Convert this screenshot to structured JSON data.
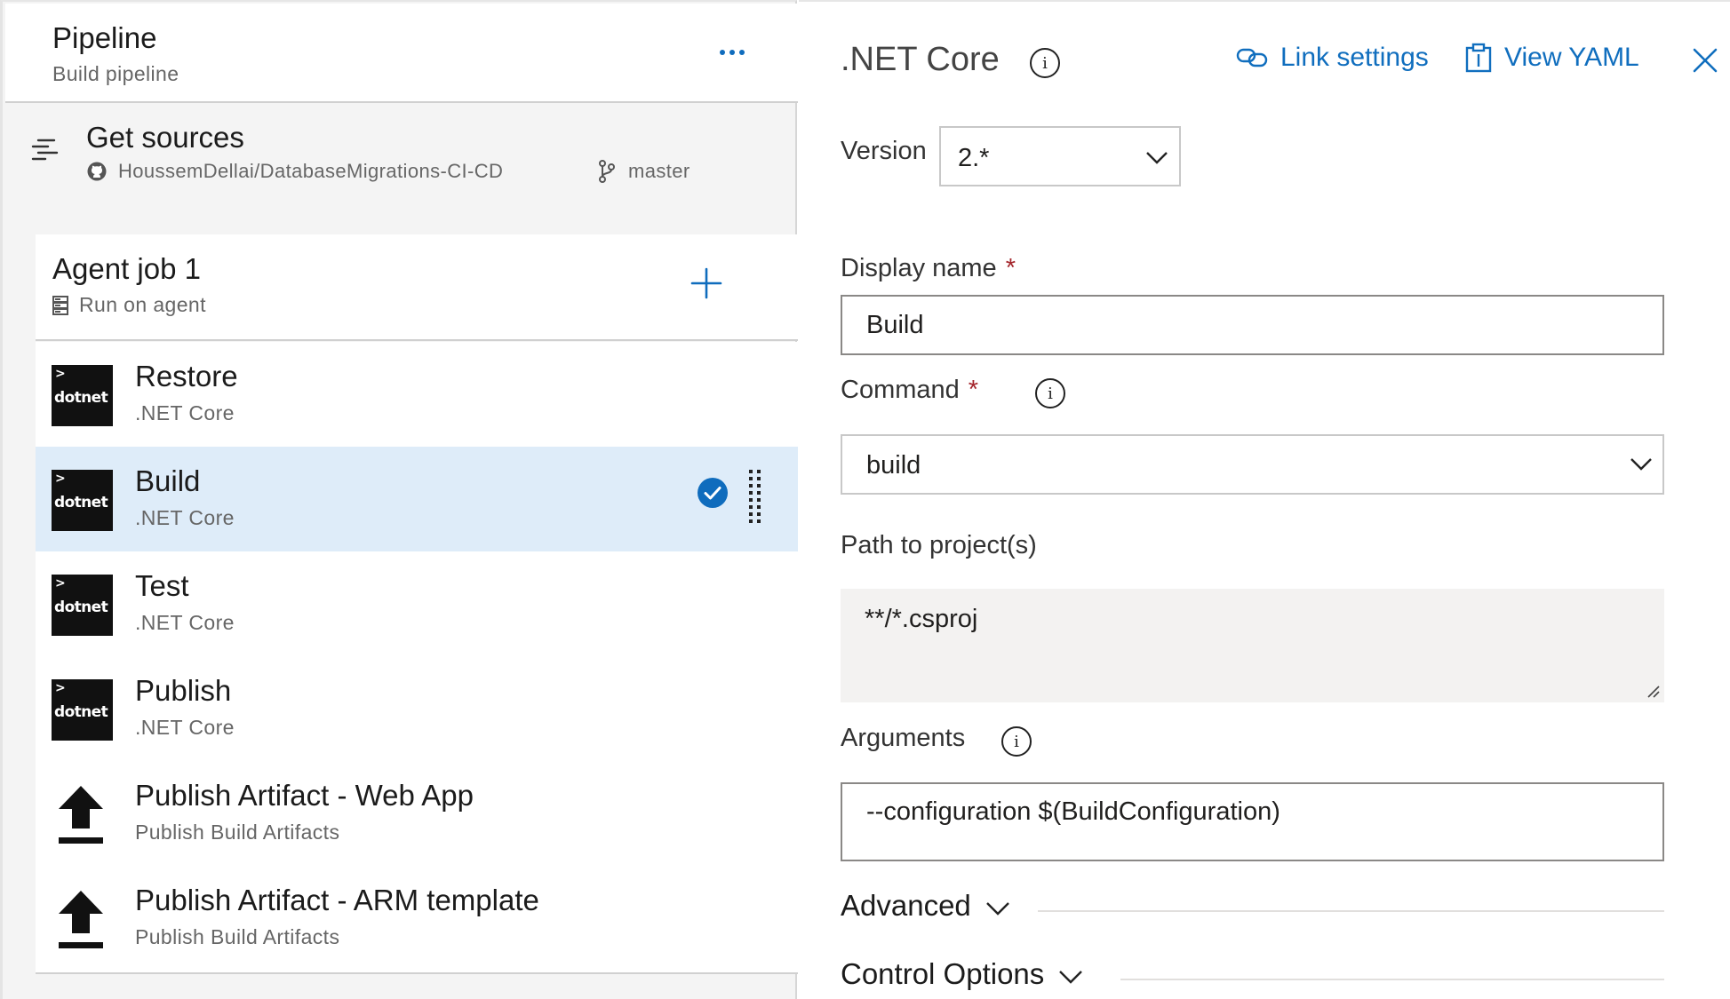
{
  "pipeline": {
    "title": "Pipeline",
    "subtitle": "Build pipeline"
  },
  "sources": {
    "title": "Get sources",
    "repo": "HoussemDellai/DatabaseMigrations-CI-CD",
    "branch": "master"
  },
  "agent_job": {
    "title": "Agent job 1",
    "subtitle": "Run on agent"
  },
  "tasks": [
    {
      "name": "Restore",
      "type": ".NET Core",
      "icon": "dotnet-logo"
    },
    {
      "name": "Build",
      "type": ".NET Core",
      "icon": "dotnet-logo",
      "selected": true
    },
    {
      "name": "Test",
      "type": ".NET Core",
      "icon": "dotnet-logo"
    },
    {
      "name": "Publish",
      "type": ".NET Core",
      "icon": "dotnet-logo"
    },
    {
      "name": "Publish Artifact - Web App",
      "type": "Publish Build Artifacts",
      "icon": "upload-icon"
    },
    {
      "name": "Publish Artifact - ARM template",
      "type": "Publish Build Artifacts",
      "icon": "upload-icon"
    }
  ],
  "dotnet_logo_text": "dotnet",
  "detail": {
    "title": ".NET Core",
    "link_settings": "Link settings",
    "view_yaml": "View YAML",
    "version": {
      "label": "Version",
      "value": "2.*"
    },
    "display_name": {
      "label": "Display name",
      "value": "Build"
    },
    "command": {
      "label": "Command",
      "value": "build"
    },
    "path": {
      "label": "Path to project(s)",
      "value": "**/*.csproj"
    },
    "arguments": {
      "label": "Arguments",
      "value": "--configuration $(BuildConfiguration)"
    },
    "sections": [
      "Advanced",
      "Control Options"
    ],
    "required_mark": "*"
  },
  "colors": {
    "accent": "#106ebe",
    "selected_row": "#deecf9",
    "required": "#a4262c"
  }
}
